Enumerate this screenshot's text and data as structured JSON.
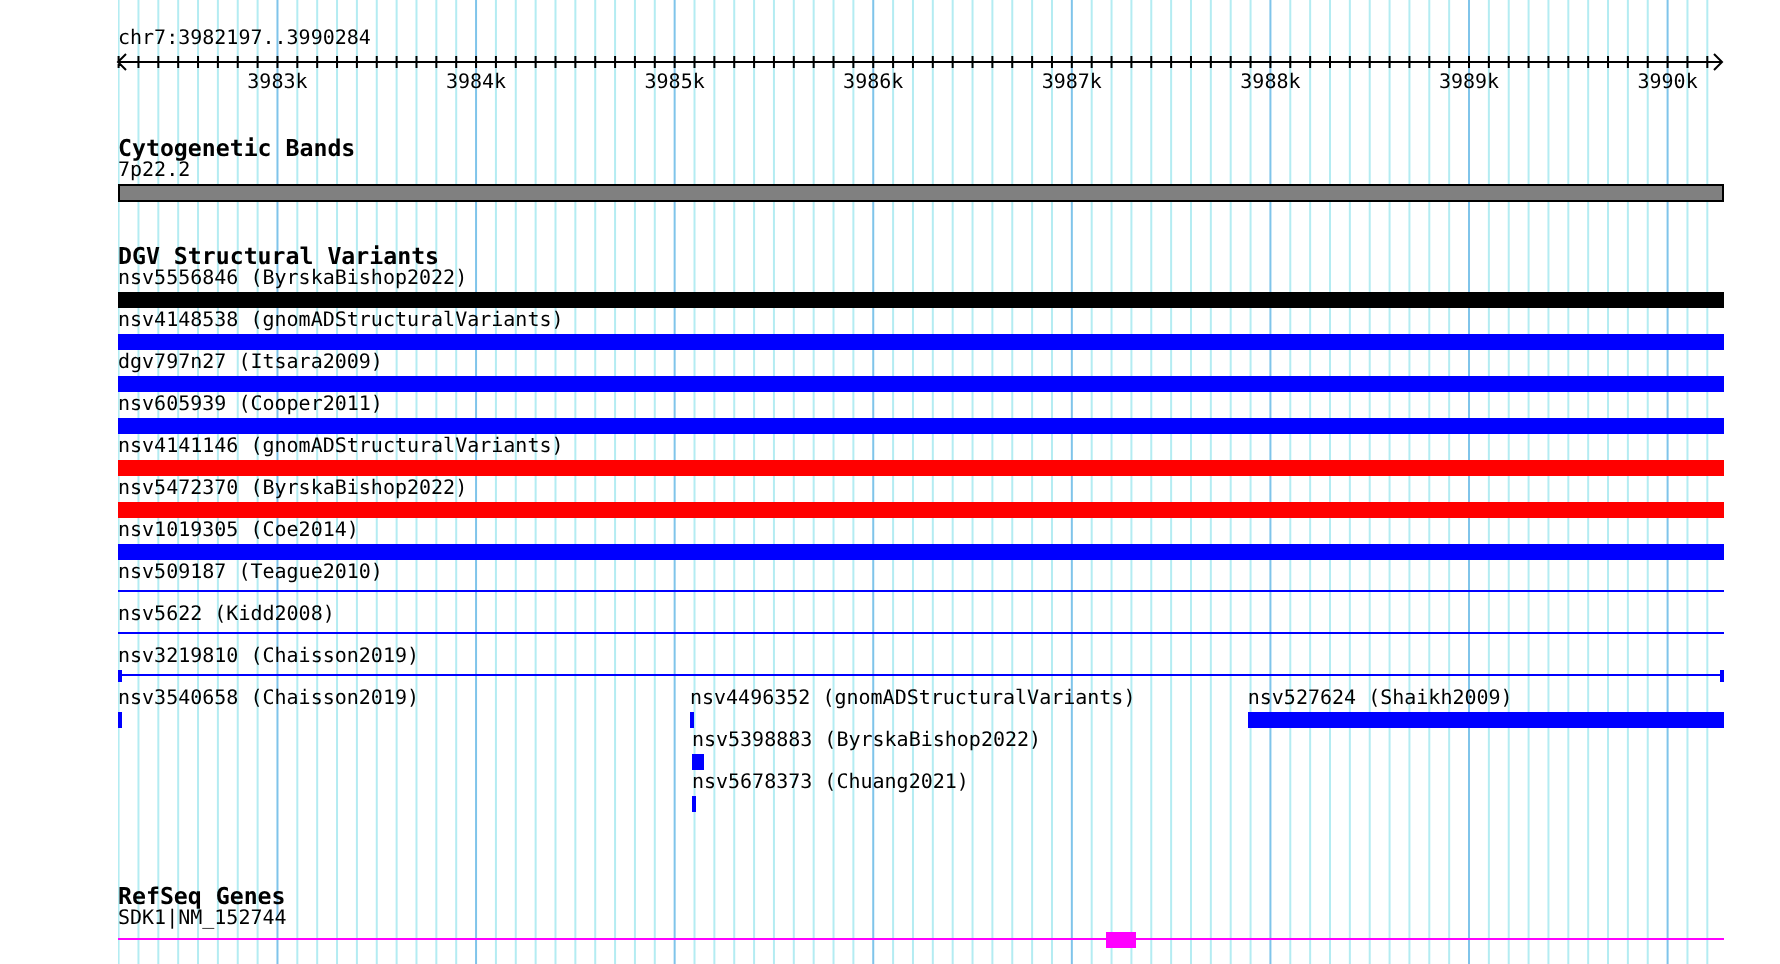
{
  "ruler": {
    "location": "chr7:3982197..3990284",
    "tick_labels": [
      "3983k",
      "3984k",
      "3985k",
      "3986k",
      "3987k",
      "3988k",
      "3989k",
      "3990k"
    ]
  },
  "cytogenetic": {
    "title": "Cytogenetic Bands",
    "bands": [
      {
        "label": "7p22.2"
      }
    ]
  },
  "dgv": {
    "title": "DGV Structural Variants",
    "rows": [
      {
        "features": [
          {
            "label": "nsv5556846 (ByrskaBishop2022)",
            "color": "#000000",
            "kind": "bar"
          }
        ]
      },
      {
        "features": [
          {
            "label": "nsv4148538 (gnomADStructuralVariants)",
            "color": "#0000ff",
            "kind": "bar"
          }
        ]
      },
      {
        "features": [
          {
            "label": "dgv797n27 (Itsara2009)",
            "color": "#0000ff",
            "kind": "bar"
          }
        ]
      },
      {
        "features": [
          {
            "label": "nsv605939 (Cooper2011)",
            "color": "#0000ff",
            "kind": "bar"
          }
        ]
      },
      {
        "features": [
          {
            "label": "nsv4141146 (gnomADStructuralVariants)",
            "color": "#ff0000",
            "kind": "bar"
          }
        ]
      },
      {
        "features": [
          {
            "label": "nsv5472370 (ByrskaBishop2022)",
            "color": "#ff0000",
            "kind": "bar"
          }
        ]
      },
      {
        "features": [
          {
            "label": "nsv1019305 (Coe2014)",
            "color": "#0000ff",
            "kind": "bar"
          }
        ]
      },
      {
        "features": [
          {
            "label": "nsv509187 (Teague2010)",
            "color": "#0000ff",
            "kind": "line"
          }
        ]
      },
      {
        "features": [
          {
            "label": "nsv5622 (Kidd2008)",
            "color": "#0000ff",
            "kind": "line"
          }
        ]
      },
      {
        "features": [
          {
            "label": "nsv3219810 (Chaisson2019)",
            "color": "#0000ff",
            "kind": "capped-line"
          }
        ]
      },
      {
        "features": [
          {
            "label": "nsv3540658 (Chaisson2019)",
            "color": "#0000ff",
            "kind": "bar"
          },
          {
            "label": "nsv4496352 (gnomADStructuralVariants)",
            "color": "#0000ff",
            "kind": "bar"
          },
          {
            "label": "nsv527624 (Shaikh2009)",
            "color": "#0000ff",
            "kind": "bar"
          }
        ]
      },
      {
        "features": [
          {
            "label": "nsv5398883 (ByrskaBishop2022)",
            "color": "#0000ff",
            "kind": "bar"
          }
        ]
      },
      {
        "features": [
          {
            "label": "nsv5678373 (Chuang2021)",
            "color": "#0000ff",
            "kind": "bar"
          }
        ]
      }
    ]
  },
  "refseq": {
    "title": "RefSeq Genes",
    "genes": [
      {
        "label": "SDK1|NM_152744"
      }
    ]
  }
}
